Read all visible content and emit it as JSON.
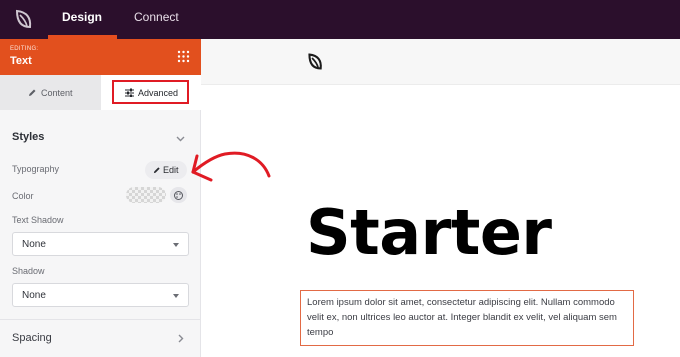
{
  "topbar": {
    "logo_icon": "seedprod-leaf-icon",
    "tabs": [
      {
        "label": "Design",
        "active": true
      },
      {
        "label": "Connect",
        "active": false
      }
    ],
    "accent": "#e54e1f",
    "background": "#2b0f2c"
  },
  "sidebar": {
    "editing_label": "EDITING:",
    "editing_title": "Text",
    "header_color": "#e2501e",
    "tabs": [
      {
        "label": "Content",
        "icon": "pencil-icon"
      },
      {
        "label": "Advanced",
        "icon": "sliders-icon",
        "active": true,
        "highlight_color": "#e01b24"
      }
    ],
    "styles": {
      "title": "Styles",
      "typography_label": "Typography",
      "edit_button": "Edit",
      "color_label": "Color",
      "text_shadow_label": "Text Shadow",
      "text_shadow_value": "None",
      "shadow_label": "Shadow",
      "shadow_value": "None"
    },
    "spacing": {
      "title": "Spacing"
    }
  },
  "canvas": {
    "header_logo_icon": "seedprod-leaf-icon",
    "heading": "Starter",
    "paragraph": "Lorem ipsum dolor sit amet, consectetur adipiscing elit. Nullam commodo velit ex, non ultrices leo auctor at. Integer blandit ex velit, vel aliquam sem tempo",
    "selection_color": "#e26a45"
  },
  "annotation": {
    "arrow_color": "#e01b24",
    "points_to": "edit-button"
  }
}
